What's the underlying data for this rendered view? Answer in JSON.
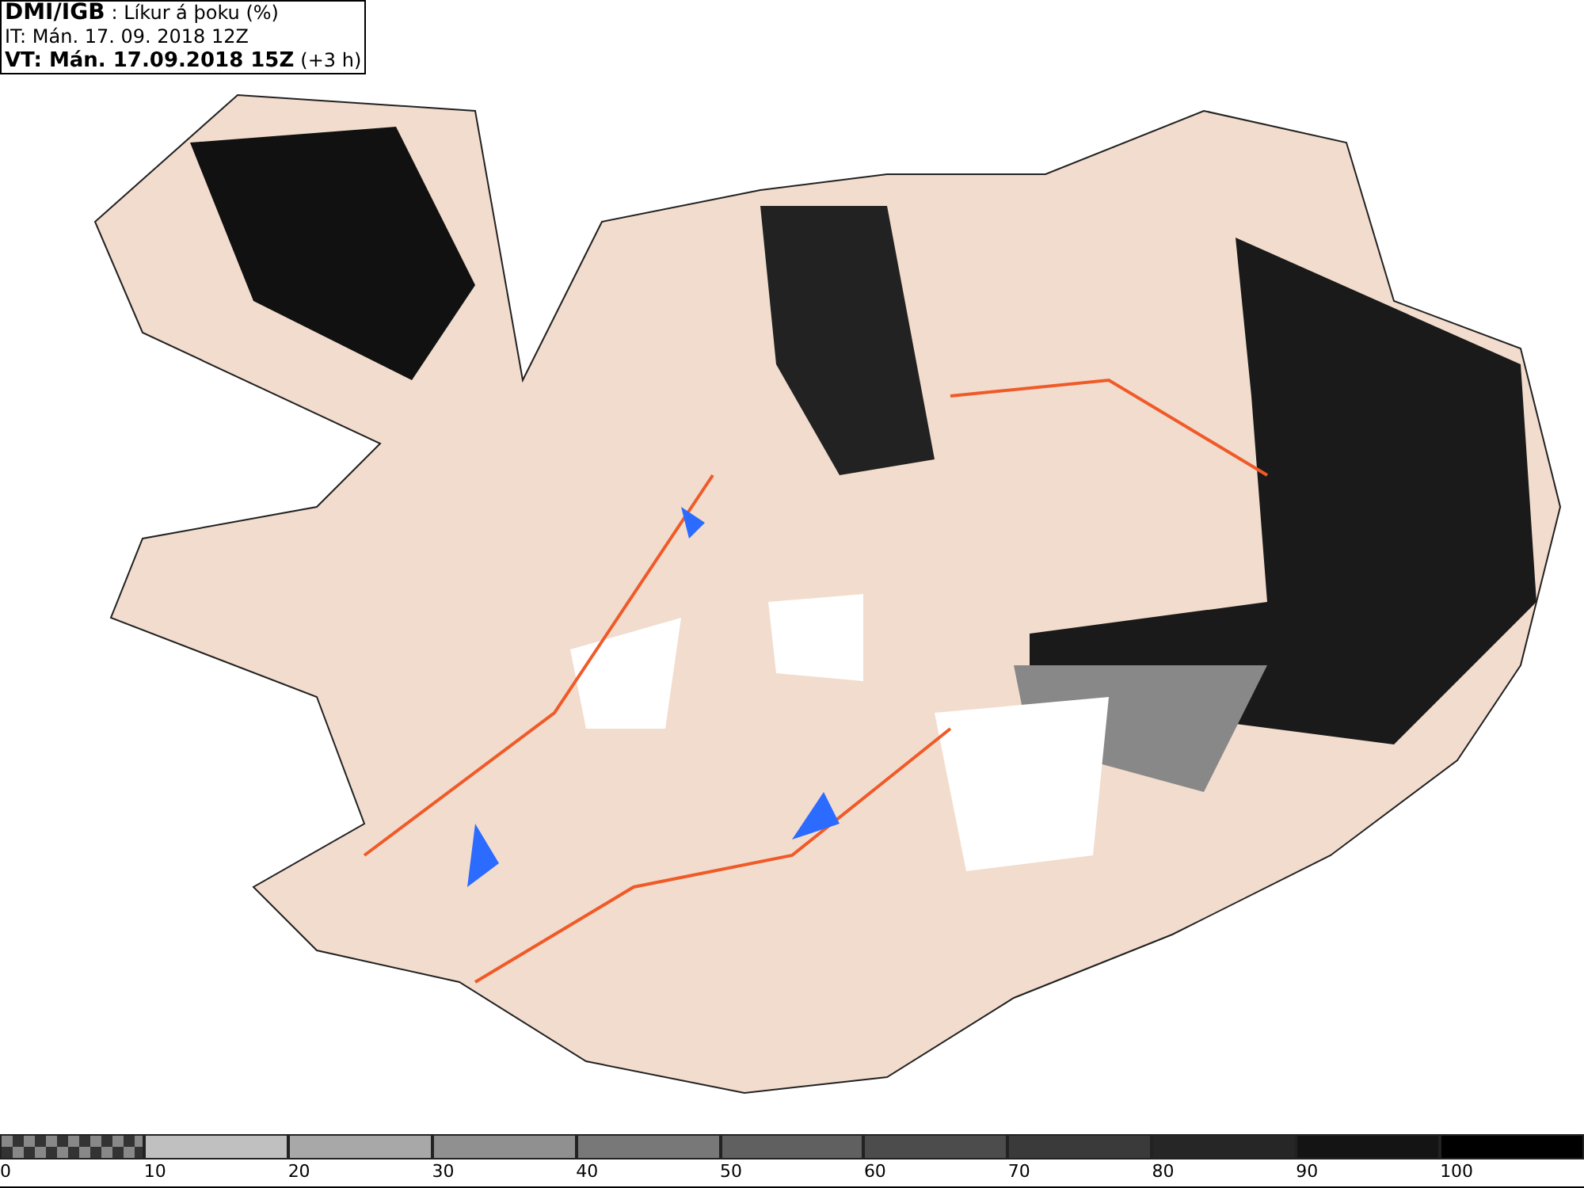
{
  "header": {
    "source": "DMI/IGB",
    "title": ": Líkur á þoku (%)",
    "issue_time": "IT: Mán. 17. 09. 2018 12Z",
    "valid_time": "VT: Mán. 17.09.2018 15Z",
    "offset": "(+3 h)"
  },
  "legend": [
    {
      "kind": "checker",
      "color": "#333333",
      "label": "0"
    },
    {
      "kind": "solid",
      "color": "#c0c0c0",
      "label": "10"
    },
    {
      "kind": "solid",
      "color": "#a8a8a8",
      "label": "20"
    },
    {
      "kind": "solid",
      "color": "#909090",
      "label": "30"
    },
    {
      "kind": "solid",
      "color": "#787878",
      "label": "40"
    },
    {
      "kind": "solid",
      "color": "#606060",
      "label": "50"
    },
    {
      "kind": "solid",
      "color": "#4c4c4c",
      "label": "60"
    },
    {
      "kind": "solid",
      "color": "#3a3a3a",
      "label": "70"
    },
    {
      "kind": "solid",
      "color": "#262626",
      "label": "80"
    },
    {
      "kind": "solid",
      "color": "#141414",
      "label": "90"
    },
    {
      "kind": "solid",
      "color": "#000000",
      "label": "100"
    }
  ]
}
